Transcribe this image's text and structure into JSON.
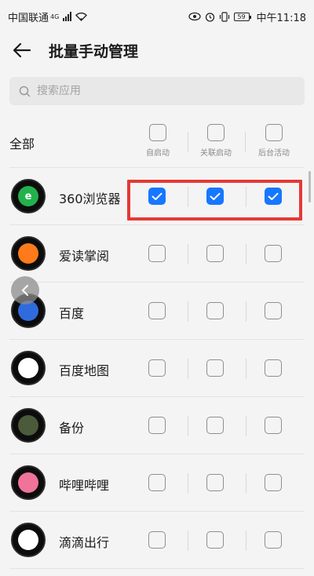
{
  "status_bar": {
    "carrier": "中国联通",
    "network": "4G",
    "battery": "59",
    "time": "中午11:18"
  },
  "header": {
    "title": "批量手动管理"
  },
  "search": {
    "placeholder": "搜索应用"
  },
  "select_all": {
    "label": "全部",
    "columns": [
      {
        "label": "自启动",
        "checked": false
      },
      {
        "label": "关联启动",
        "checked": false
      },
      {
        "label": "后台活动",
        "checked": false
      }
    ]
  },
  "apps": [
    {
      "name": "360浏览器",
      "icon": "360-browser-icon",
      "color": "#22b14c",
      "glyph": "e",
      "checks": [
        true,
        true,
        true
      ]
    },
    {
      "name": "爱读掌阅",
      "icon": "ireader-icon",
      "color": "#ff7a1a",
      "glyph": "",
      "checks": [
        false,
        false,
        false
      ]
    },
    {
      "name": "百度",
      "icon": "baidu-icon",
      "color": "#2f6bdc",
      "glyph": "",
      "checks": [
        false,
        false,
        false
      ]
    },
    {
      "name": "百度地图",
      "icon": "baidu-map-icon",
      "color": "#ffffff",
      "glyph": "",
      "checks": [
        false,
        false,
        false
      ]
    },
    {
      "name": "备份",
      "icon": "backup-icon",
      "color": "#4a5a3a",
      "glyph": "",
      "checks": [
        false,
        false,
        false
      ]
    },
    {
      "name": "哔哩哔哩",
      "icon": "bilibili-icon",
      "color": "#f0739a",
      "glyph": "",
      "checks": [
        false,
        false,
        false
      ]
    },
    {
      "name": "滴滴出行",
      "icon": "didi-icon",
      "color": "#ffffff",
      "glyph": "",
      "checks": [
        false,
        false,
        false
      ]
    }
  ],
  "accent_color": "#1677ff",
  "highlight_color": "#e53935"
}
